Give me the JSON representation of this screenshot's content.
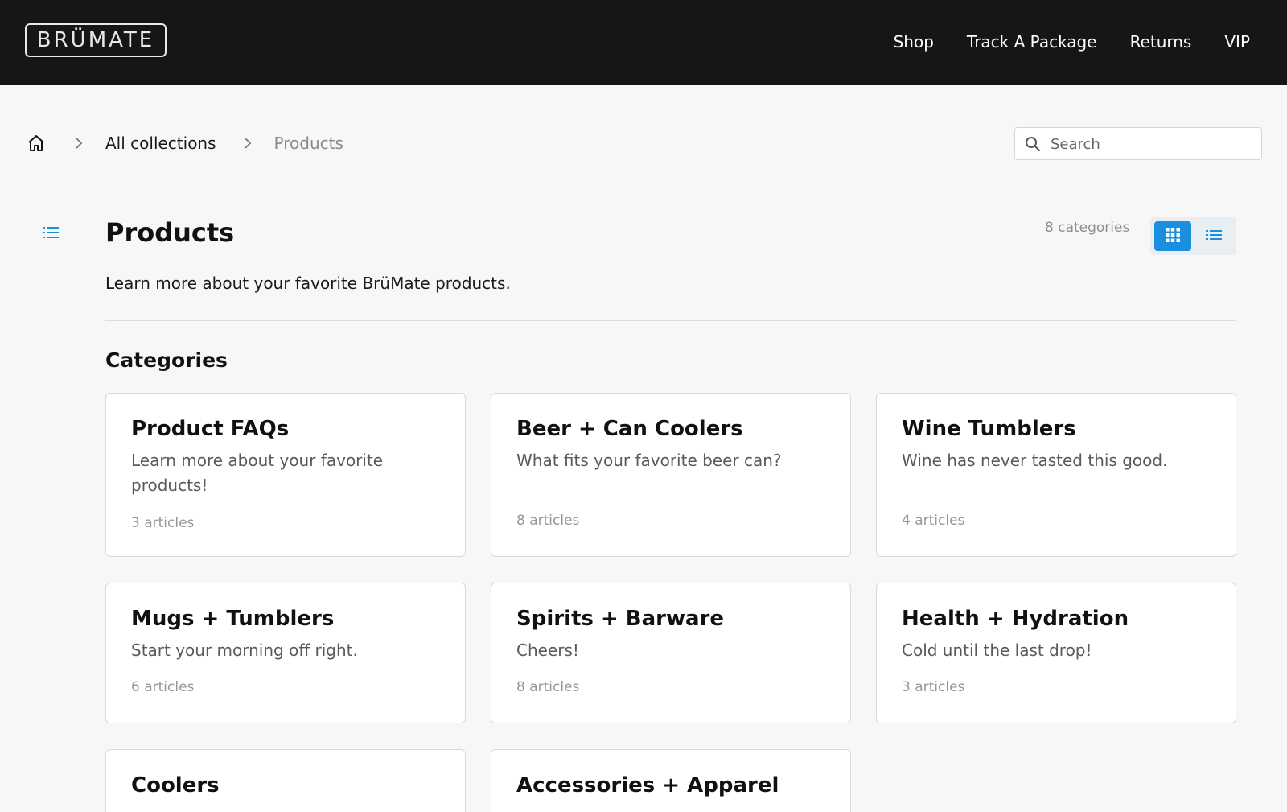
{
  "header": {
    "logo_text": "BRÜMATE",
    "nav": [
      "Shop",
      "Track A Package",
      "Returns",
      "VIP"
    ]
  },
  "breadcrumb": {
    "items": [
      "All collections",
      "Products"
    ]
  },
  "search": {
    "placeholder": "Search"
  },
  "page": {
    "title": "Products",
    "description": "Learn more about your favorite BrüMate products.",
    "category_count": "8 categories",
    "section_title": "Categories"
  },
  "categories": [
    {
      "title": "Product FAQs",
      "description": "Learn more about your favorite products!",
      "articles": "3 articles"
    },
    {
      "title": "Beer + Can Coolers",
      "description": "What fits your favorite beer can?",
      "articles": "8 articles"
    },
    {
      "title": "Wine Tumblers",
      "description": "Wine has never tasted this good.",
      "articles": "4 articles"
    },
    {
      "title": "Mugs + Tumblers",
      "description": "Start your morning off right.",
      "articles": "6 articles"
    },
    {
      "title": "Spirits + Barware",
      "description": "Cheers!",
      "articles": "8 articles"
    },
    {
      "title": "Health + Hydration",
      "description": "Cold until the last drop!",
      "articles": "3 articles"
    },
    {
      "title": "Coolers",
      "description": "",
      "articles": ""
    },
    {
      "title": "Accessories + Apparel",
      "description": "",
      "articles": ""
    }
  ],
  "colors": {
    "accent": "#1a8fe0",
    "topbar": "#161616"
  }
}
